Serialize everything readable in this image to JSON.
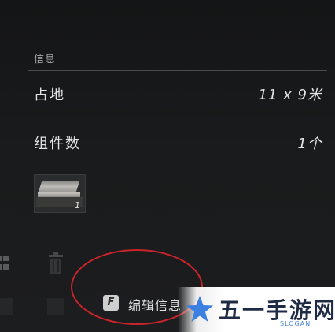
{
  "info": {
    "section_title": "信息",
    "footprint_label": "占地",
    "footprint_value": "11 x 9米",
    "components_label": "组件数",
    "components_value": "1个"
  },
  "components": [
    {
      "count": "1",
      "icon": "stone-slab-thumbnail"
    }
  ],
  "actions": {
    "edit_key": "F",
    "edit_label": "编辑信息"
  },
  "side_icons": [
    "grid-icon",
    "trash-icon"
  ],
  "annotation": {
    "ring_color": "#c8242b"
  },
  "watermark": {
    "text": "五一手游网",
    "slogan": "SLOGAN",
    "star_color": "#3b7fe0"
  }
}
